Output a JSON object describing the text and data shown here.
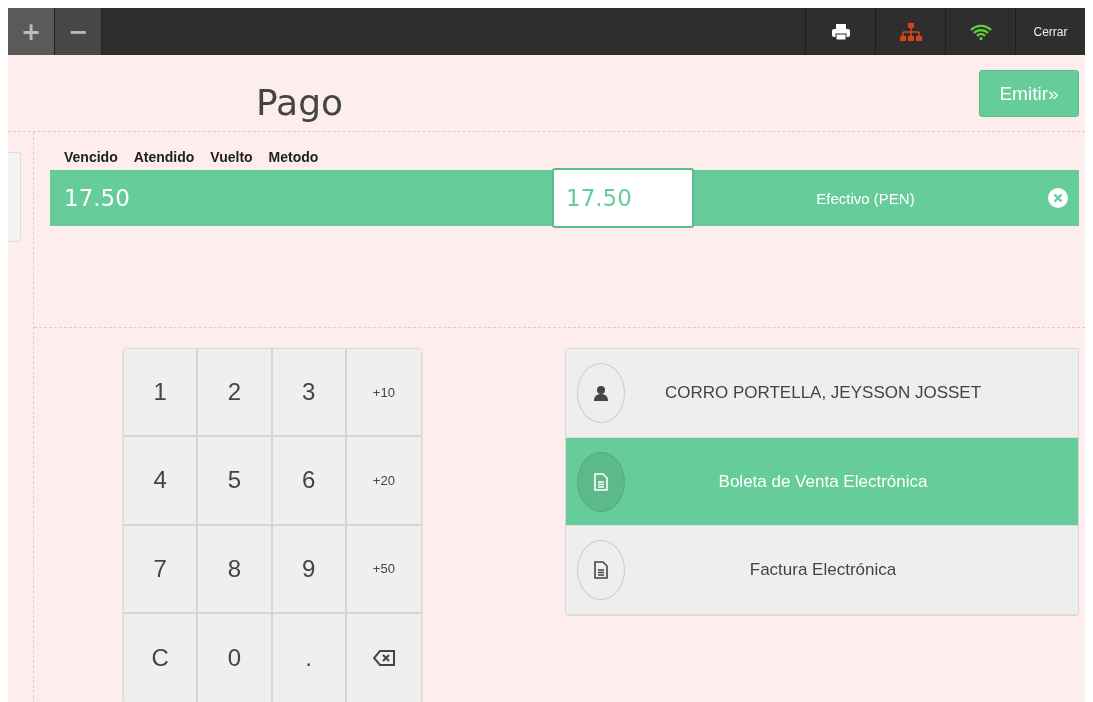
{
  "toolbar": {
    "left_buttons": [
      {
        "label": "+"
      },
      {
        "label": "−"
      }
    ],
    "right_items": [
      {
        "kind": "printer"
      },
      {
        "kind": "network"
      },
      {
        "kind": "wifi"
      },
      {
        "kind": "text",
        "label": "Cerrar"
      }
    ]
  },
  "header": {
    "title": "Pago",
    "emit_button": {
      "label": "Emitir",
      "suffix": "»"
    }
  },
  "payment_table": {
    "columns": [
      "Vencido",
      "Atendido",
      "Vuelto",
      "Metodo"
    ],
    "rows": [
      {
        "due": "17.50",
        "tendered": "17.50",
        "method": "Efectivo (PEN)",
        "selected": true
      }
    ]
  },
  "keypad": [
    {
      "kind": "digit",
      "label": "1"
    },
    {
      "kind": "digit",
      "label": "2"
    },
    {
      "kind": "digit",
      "label": "3"
    },
    {
      "kind": "small",
      "label": "+10"
    },
    {
      "kind": "digit",
      "label": "4"
    },
    {
      "kind": "digit",
      "label": "5"
    },
    {
      "kind": "digit",
      "label": "6"
    },
    {
      "kind": "small",
      "label": "+20"
    },
    {
      "kind": "digit",
      "label": "7"
    },
    {
      "kind": "digit",
      "label": "8"
    },
    {
      "kind": "digit",
      "label": "9"
    },
    {
      "kind": "small",
      "label": "+50"
    },
    {
      "kind": "digit",
      "label": "C"
    },
    {
      "kind": "digit",
      "label": "0"
    },
    {
      "kind": "digit",
      "label": "."
    },
    {
      "kind": "backspace"
    }
  ],
  "options": [
    {
      "kind": "customer",
      "label": "CORRO PORTELLA, JEYSSON JOSSET",
      "selected": false
    },
    {
      "kind": "document",
      "label": "Boleta de Venta Electrónica",
      "selected": true
    },
    {
      "kind": "document",
      "label": "Factura Electrónica",
      "selected": false
    }
  ]
}
